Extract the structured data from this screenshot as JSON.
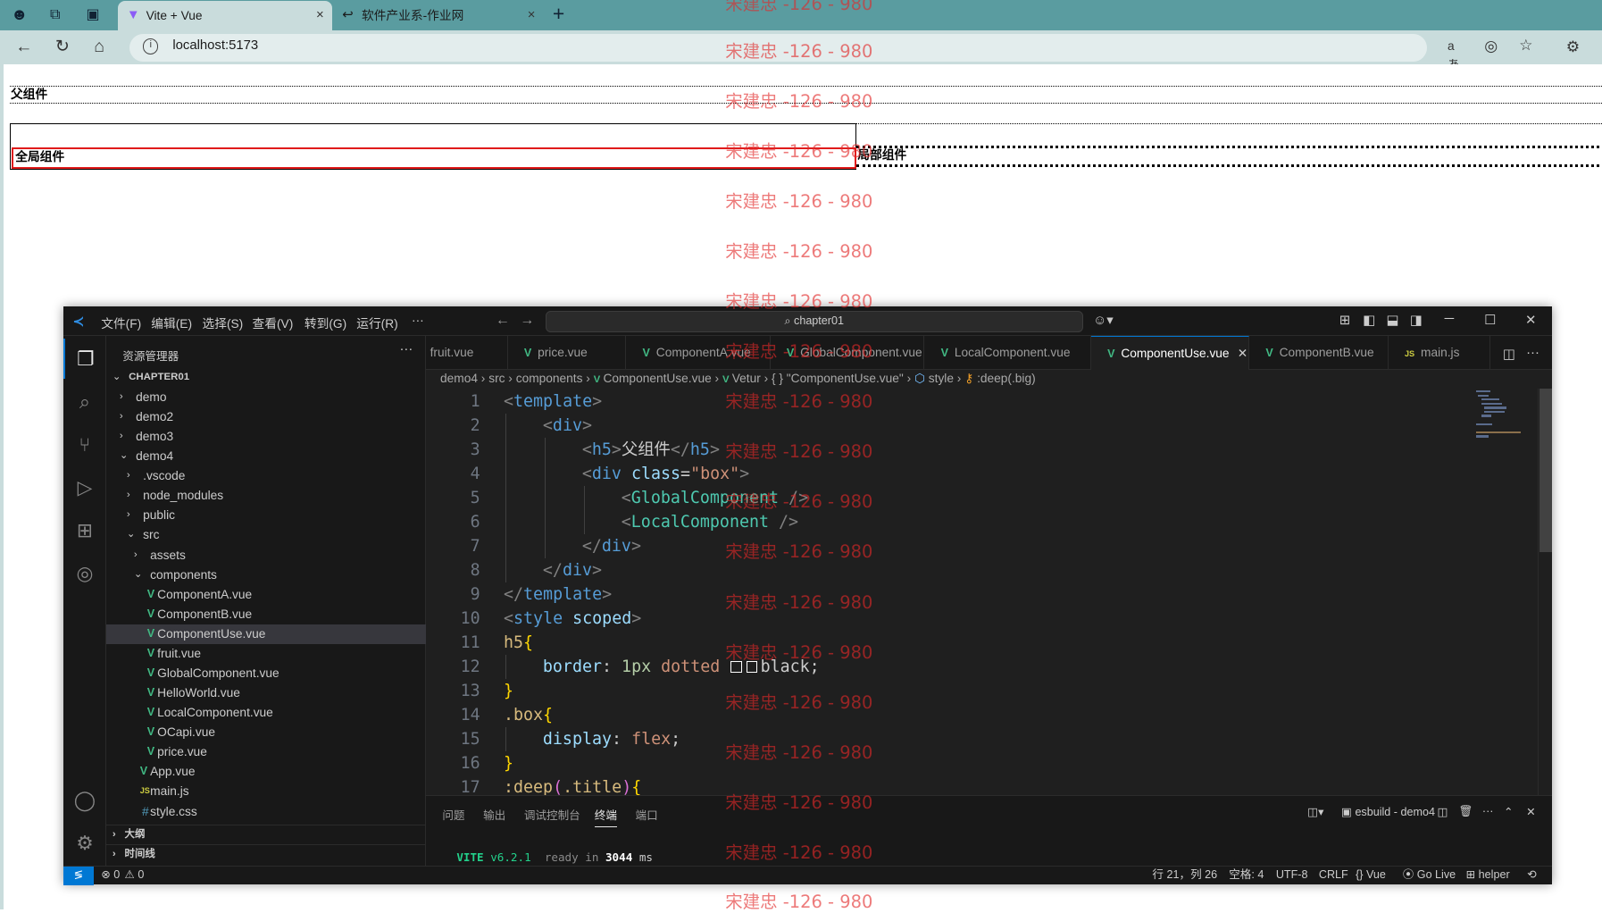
{
  "browser": {
    "tabs": [
      {
        "title": "Vite + Vue",
        "close": "×"
      },
      {
        "title": "软件产业系-作业网",
        "close": "×"
      }
    ],
    "new_tab": "+",
    "url": "localhost:5173",
    "info_glyph": "i"
  },
  "app": {
    "parent_heading": "父组件",
    "global_component": "全局组件",
    "local_component": "局部组件"
  },
  "vscode": {
    "menu": [
      "文件(F)",
      "编辑(E)",
      "选择(S)",
      "查看(V)",
      "转到(G)",
      "运行(R)",
      "···"
    ],
    "command_center": "chapter01",
    "explorer_title": "资源管理器",
    "explorer_more": "···",
    "tree": [
      {
        "label": "CHAPTER01",
        "depth": 0,
        "kind": "folder-open",
        "bold": true
      },
      {
        "label": "demo",
        "depth": 1,
        "kind": "folder"
      },
      {
        "label": "demo2",
        "depth": 1,
        "kind": "folder"
      },
      {
        "label": "demo3",
        "depth": 1,
        "kind": "folder"
      },
      {
        "label": "demo4",
        "depth": 1,
        "kind": "folder-open"
      },
      {
        "label": ".vscode",
        "depth": 2,
        "kind": "folder"
      },
      {
        "label": "node_modules",
        "depth": 2,
        "kind": "folder"
      },
      {
        "label": "public",
        "depth": 2,
        "kind": "folder"
      },
      {
        "label": "src",
        "depth": 2,
        "kind": "folder-open"
      },
      {
        "label": "assets",
        "depth": 3,
        "kind": "folder"
      },
      {
        "label": "components",
        "depth": 3,
        "kind": "folder-open"
      },
      {
        "label": "ComponentA.vue",
        "depth": 4,
        "kind": "vue"
      },
      {
        "label": "ComponentB.vue",
        "depth": 4,
        "kind": "vue"
      },
      {
        "label": "ComponentUse.vue",
        "depth": 4,
        "kind": "vue",
        "selected": true
      },
      {
        "label": "fruit.vue",
        "depth": 4,
        "kind": "vue"
      },
      {
        "label": "GlobalComponent.vue",
        "depth": 4,
        "kind": "vue"
      },
      {
        "label": "HelloWorld.vue",
        "depth": 4,
        "kind": "vue"
      },
      {
        "label": "LocalComponent.vue",
        "depth": 4,
        "kind": "vue"
      },
      {
        "label": "OCapi.vue",
        "depth": 4,
        "kind": "vue"
      },
      {
        "label": "price.vue",
        "depth": 4,
        "kind": "vue"
      },
      {
        "label": "App.vue",
        "depth": 3,
        "kind": "vue"
      },
      {
        "label": "main.js",
        "depth": 3,
        "kind": "js"
      },
      {
        "label": "style.css",
        "depth": 3,
        "kind": "css"
      }
    ],
    "outline": "大纲",
    "timeline": "时间线",
    "editor_tabs": [
      {
        "label": "fruit.vue",
        "kind": "none"
      },
      {
        "label": "price.vue",
        "kind": "vue"
      },
      {
        "label": "ComponentA.vue",
        "kind": "vue"
      },
      {
        "label": "GlobalComponent.vue",
        "kind": "vue"
      },
      {
        "label": "LocalComponent.vue",
        "kind": "vue"
      },
      {
        "label": "ComponentUse.vue",
        "kind": "vue",
        "active": true
      },
      {
        "label": "ComponentB.vue",
        "kind": "vue"
      },
      {
        "label": "main.js",
        "kind": "js"
      }
    ],
    "breadcrumb": [
      "demo4",
      "src",
      "components",
      "ComponentUse.vue",
      "Vetur",
      "{ } \"ComponentUse.vue\"",
      "style",
      ":deep(.big)"
    ],
    "code_lines": [
      {
        "n": "1",
        "indent": 0,
        "tokens": [
          [
            "<",
            "t-br"
          ],
          [
            "template",
            "t-tag"
          ],
          [
            ">",
            "t-br"
          ]
        ]
      },
      {
        "n": "2",
        "indent": 1,
        "tokens": [
          [
            "<",
            "t-br"
          ],
          [
            "div",
            "t-tag"
          ],
          [
            ">",
            "t-br"
          ]
        ]
      },
      {
        "n": "3",
        "indent": 2,
        "tokens": [
          [
            "<",
            "t-br"
          ],
          [
            "h5",
            "t-tag"
          ],
          [
            ">",
            "t-br"
          ],
          [
            "父组件",
            "t-txt"
          ],
          [
            "</",
            "t-br"
          ],
          [
            "h5",
            "t-tag"
          ],
          [
            ">",
            "t-br"
          ]
        ]
      },
      {
        "n": "4",
        "indent": 2,
        "tokens": [
          [
            "<",
            "t-br"
          ],
          [
            "div",
            "t-tag"
          ],
          [
            " ",
            "t-pl"
          ],
          [
            "class",
            "t-attr"
          ],
          [
            "=",
            "t-pl"
          ],
          [
            "\"box\"",
            "t-str"
          ],
          [
            ">",
            "t-br"
          ]
        ]
      },
      {
        "n": "5",
        "indent": 3,
        "tokens": [
          [
            "<",
            "t-br"
          ],
          [
            "GlobalComponent",
            "t-cmp"
          ],
          [
            " />",
            "t-br"
          ]
        ]
      },
      {
        "n": "6",
        "indent": 3,
        "tokens": [
          [
            "<",
            "t-br"
          ],
          [
            "LocalComponent",
            "t-cmp"
          ],
          [
            " />",
            "t-br"
          ]
        ]
      },
      {
        "n": "7",
        "indent": 2,
        "tokens": [
          [
            "</",
            "t-br"
          ],
          [
            "div",
            "t-tag"
          ],
          [
            ">",
            "t-br"
          ]
        ]
      },
      {
        "n": "8",
        "indent": 1,
        "tokens": [
          [
            "</",
            "t-br"
          ],
          [
            "div",
            "t-tag"
          ],
          [
            ">",
            "t-br"
          ]
        ]
      },
      {
        "n": "9",
        "indent": 0,
        "tokens": [
          [
            "</",
            "t-br"
          ],
          [
            "template",
            "t-tag"
          ],
          [
            ">",
            "t-br"
          ]
        ]
      },
      {
        "n": "10",
        "indent": 0,
        "tokens": [
          [
            "<",
            "t-br"
          ],
          [
            "style",
            "t-tag"
          ],
          [
            " ",
            "t-pl"
          ],
          [
            "scoped",
            "t-attr"
          ],
          [
            ">",
            "t-br"
          ]
        ]
      },
      {
        "n": "11",
        "indent": 0,
        "tokens": [
          [
            "h5",
            "t-sel"
          ],
          [
            "{",
            "t-brace"
          ]
        ]
      },
      {
        "n": "12",
        "indent": 1,
        "tokens": [
          [
            "border",
            "t-prop"
          ],
          [
            ": ",
            "t-pl"
          ],
          [
            "1px",
            "t-num"
          ],
          [
            " ",
            "t-pl"
          ],
          [
            "dotted",
            "t-val"
          ],
          [
            " ",
            "t-pl"
          ],
          [
            "SWATCH",
            "swatch"
          ],
          [
            "black",
            "t-pl"
          ],
          [
            ";",
            "t-pl"
          ]
        ]
      },
      {
        "n": "13",
        "indent": 0,
        "tokens": [
          [
            "}",
            "t-brace"
          ]
        ]
      },
      {
        "n": "14",
        "indent": 0,
        "tokens": [
          [
            ".box",
            "t-sel"
          ],
          [
            "{",
            "t-brace"
          ]
        ]
      },
      {
        "n": "15",
        "indent": 1,
        "tokens": [
          [
            "display",
            "t-prop"
          ],
          [
            ": ",
            "t-pl"
          ],
          [
            "flex",
            "t-val"
          ],
          [
            ";",
            "t-pl"
          ]
        ]
      },
      {
        "n": "16",
        "indent": 0,
        "tokens": [
          [
            "}",
            "t-brace"
          ]
        ]
      },
      {
        "n": "17",
        "indent": 0,
        "tokens": [
          [
            ":deep",
            "t-sel"
          ],
          [
            "(",
            "t-brace2"
          ],
          [
            ".title",
            "t-sel"
          ],
          [
            ")",
            "t-brace2"
          ],
          [
            "{",
            "t-brace"
          ]
        ]
      }
    ],
    "panel_tabs": [
      "问题",
      "输出",
      "调试控制台",
      "终端",
      "端口"
    ],
    "panel_active": "终端",
    "terminal_session": "esbuild - demo4",
    "terminal_line": {
      "vite": "VITE",
      "ver": "v6.2.1",
      "ready": "ready in",
      "ms": "3044",
      "unit": "ms"
    },
    "status": {
      "errors": "⊗ 0",
      "warnings": "⚠ 0",
      "position": "行 21，列 26",
      "spaces": "空格: 4",
      "encoding": "UTF-8",
      "eol": "CRLF",
      "lang": "Vue",
      "golive": "Go Live",
      "helper": "helper"
    },
    "accent": "#0078d4",
    "vue_green": "#41b883"
  },
  "watermark": "宋建忠 -126 - 980"
}
